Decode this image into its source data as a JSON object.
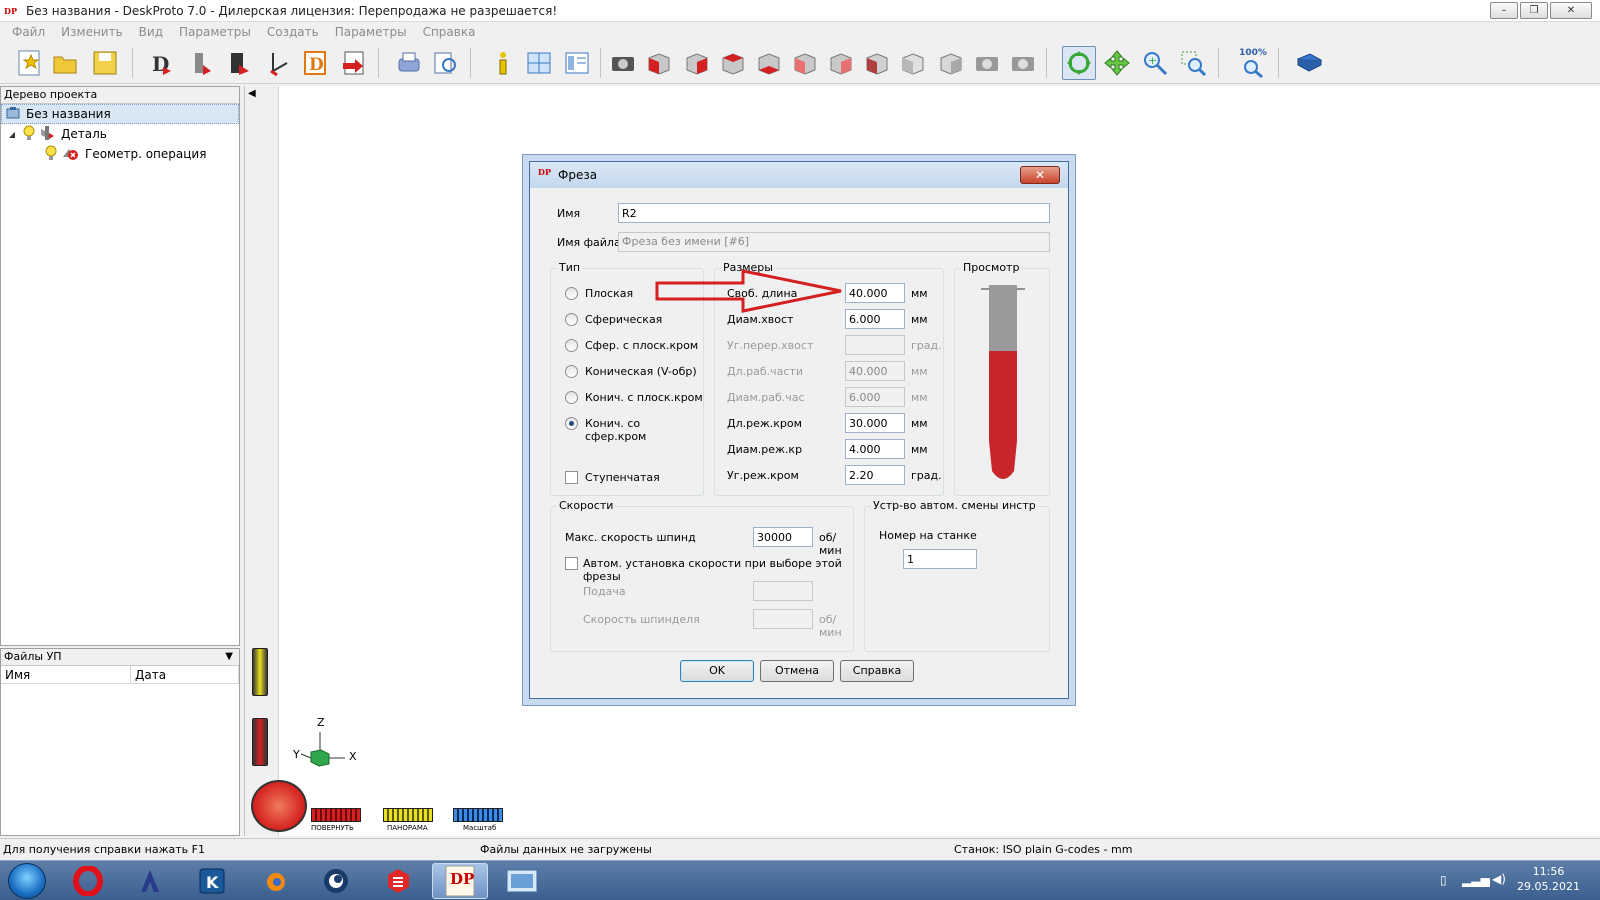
{
  "window": {
    "title": "Без названия - DeskProto 7.0 - Дилерская лицензия: Перепродажа не разрешается!",
    "min": "–",
    "max": "❐",
    "close": "✕"
  },
  "menu": [
    "Файл",
    "Изменить",
    "Вид",
    "Параметры",
    "Создать",
    "Параметры",
    "Справка"
  ],
  "tree": {
    "header": "Дерево проекта",
    "root": "Без названия",
    "part": "Деталь",
    "operation": "Геометр. операция"
  },
  "files": {
    "header": "Файлы УП",
    "col_name": "Имя",
    "col_date": "Дата"
  },
  "viewport": {
    "axis_z": "Z",
    "axis_x": "X",
    "axis_y": "Y",
    "rotate_label": "ПОВЕРНУТЬ",
    "pan_label": "ПАНОРАМА",
    "zoom_label": "Масштаб"
  },
  "toolbar": {
    "zoom100_label": "100%"
  },
  "status": {
    "help": "Для получения справки нажать F1",
    "files": "Файлы данных не загружены",
    "machine": "Станок: ISO plain G-codes - mm"
  },
  "clock": {
    "time": "11:56",
    "date": "29.05.2021"
  },
  "dialog": {
    "title": "Фреза",
    "name_label": "Имя",
    "name_value": "R2",
    "file_label": "Имя файла",
    "file_value": "Фреза без имени [#6]",
    "type_group": "Тип",
    "types": [
      "Плоская",
      "Сферическая",
      "Сфер. с плоск.кром",
      "Коническая (V-обр)",
      "Конич. с плоск.кром",
      "Конич. со сфер.кром"
    ],
    "selected_type": "Конич. со сфер.кром",
    "stepped": "Ступенчатая",
    "dims_group": "Размеры",
    "dims": [
      {
        "label": "Своб. длина",
        "value": "40.000",
        "unit": "мм",
        "enabled": true
      },
      {
        "label": "Диам.хвост",
        "value": "6.000",
        "unit": "мм",
        "enabled": true
      },
      {
        "label": "Уг.перер.хвост",
        "value": "",
        "unit": "град.",
        "enabled": false
      },
      {
        "label": "Дл.раб.части",
        "value": "40.000",
        "unit": "мм",
        "enabled": false
      },
      {
        "label": "Диам.раб.час",
        "value": "6.000",
        "unit": "мм",
        "enabled": false
      },
      {
        "label": "Дл.реж.кром",
        "value": "30.000",
        "unit": "мм",
        "enabled": true
      },
      {
        "label": "Диам.реж.кр",
        "value": "4.000",
        "unit": "мм",
        "enabled": true
      },
      {
        "label": "Уг.реж.кром",
        "value": "2.20",
        "unit": "град.",
        "enabled": true
      }
    ],
    "preview_group": "Просмотр",
    "speeds_group": "Скорости",
    "max_spindle_label": "Макс. скорость шпинд",
    "max_spindle_value": "30000",
    "rpm_unit": "об/мин",
    "auto_speed_label": "Автом. установка скорости при выборе этой фрезы",
    "feed_label": "Подача",
    "spindle_speed_label": "Скорость шпинделя",
    "atc_group": "Устр-во автом. смены инстр",
    "machine_number_label": "Номер на станке",
    "machine_number_value": "1",
    "ok": "OK",
    "cancel": "Отмена",
    "help": "Справка"
  },
  "colors": {
    "accent_red": "#d42020",
    "tool_red": "#c8262a",
    "tool_gray": "#9a9a9a"
  }
}
